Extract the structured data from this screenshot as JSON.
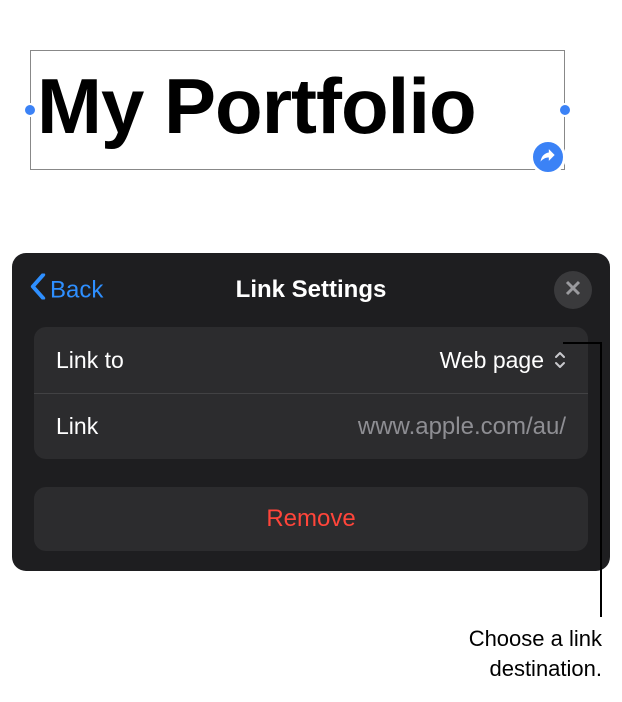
{
  "canvas": {
    "textbox_content": "My Portfolio"
  },
  "popover": {
    "back_label": "Back",
    "title": "Link Settings",
    "rows": {
      "link_to": {
        "label": "Link to",
        "value": "Web page"
      },
      "link": {
        "label": "Link",
        "placeholder": "www.apple.com/au/"
      }
    },
    "remove_label": "Remove"
  },
  "callout": {
    "line1": "Choose a link",
    "line2": "destination."
  }
}
